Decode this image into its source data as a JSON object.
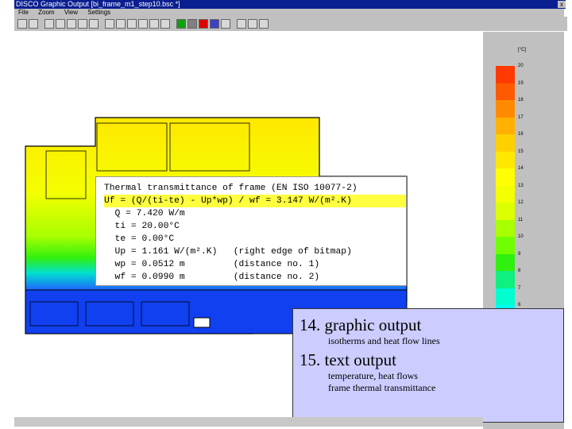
{
  "window": {
    "title": "DISCO   Graphic Output [bi_frame_m1_step10.bsc *]",
    "close": "x"
  },
  "menu": [
    "File",
    "Zoom",
    "View",
    "Settings"
  ],
  "toolbar": [
    "save",
    "print",
    "hand",
    "zoom",
    "zoom-out",
    "forward",
    "grid",
    "back",
    "isotherm",
    "flow",
    "cursor",
    "dots",
    "arrows",
    "M",
    "C",
    "red",
    "frame",
    "page",
    "text-a",
    "text-b",
    "lines"
  ],
  "legend": {
    "unit": "[°C]",
    "labels": [
      "20",
      "19",
      "18",
      "17",
      "16",
      "15",
      "14",
      "13",
      "12",
      "11",
      "10",
      "9",
      "8",
      "7",
      "6"
    ],
    "colors": [
      "#ff3a00",
      "#ff5a00",
      "#ff8a00",
      "#ffb000",
      "#ffd000",
      "#ffe800",
      "#ffff00",
      "#f4ff00",
      "#dcff00",
      "#a8ff00",
      "#70ff00",
      "#30f010",
      "#10f080",
      "#00ffd0",
      "#00fff0"
    ]
  },
  "info": {
    "lines": [
      "Thermal transmittance of frame (EN ISO 10077-2)",
      "Uf = (Q/(ti-te) - Up*wp) / wf = 3.147 W/(m².K)",
      "  Q = 7.420 W/m",
      "  ti = 20.00°C",
      "  te = 0.00°C",
      "  Up = 1.161 W/(m².K)   (right edge of bitmap)",
      "  wp = 0.0512 m         (distance no. 1)",
      "  wf = 0.0990 m         (distance no. 2)"
    ]
  },
  "note": {
    "h1": "14. graphic output",
    "s1": "isotherms and heat flow lines",
    "h2": "15. text output",
    "s2a": "temperature, heat flows",
    "s2b": "frame thermal transmittance"
  }
}
